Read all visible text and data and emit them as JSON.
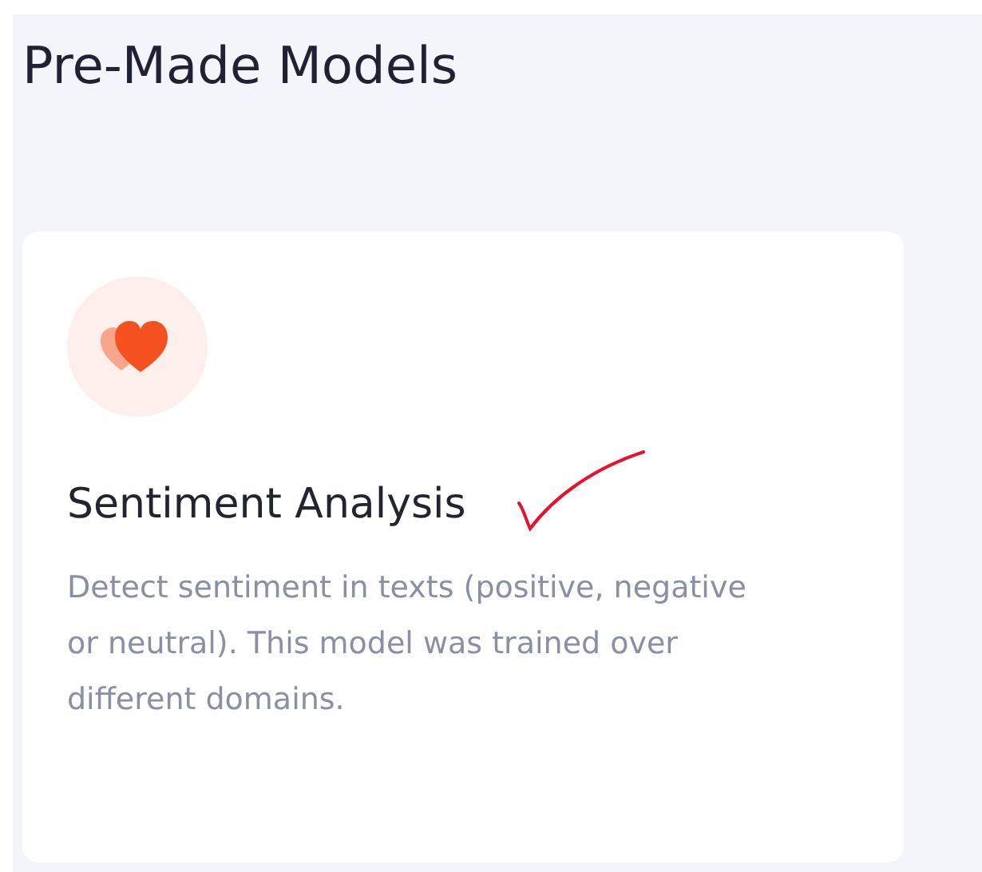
{
  "page": {
    "title": "Pre-Made Models"
  },
  "models": [
    {
      "title": "Sentiment Analysis",
      "description": "Detect sentiment in texts (positive, negative or neutral). This model was trained over different domains.",
      "checked": true
    }
  ]
}
